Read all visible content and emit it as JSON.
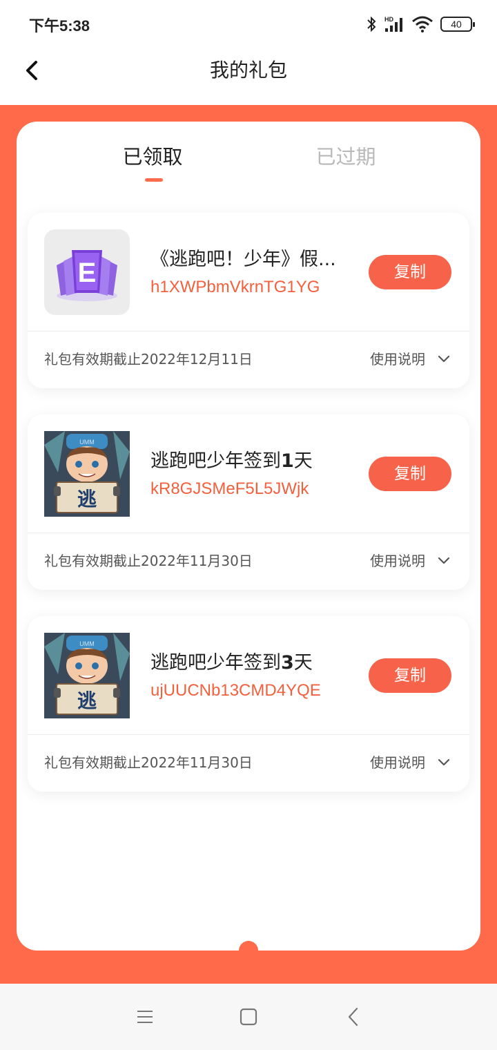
{
  "status_bar": {
    "time": "下午5:38",
    "icons": [
      "bluetooth-icon",
      "signal-icon",
      "wifi-icon"
    ],
    "hd_label": "HD",
    "battery": "40"
  },
  "header": {
    "title": "我的礼包",
    "back_icon": "chevron-left-icon"
  },
  "tabs": [
    {
      "label": "已领取",
      "active": true
    },
    {
      "label": "已过期",
      "active": false
    }
  ],
  "colors": {
    "accent": "#ff6b4a",
    "code_text": "#f2603e",
    "inactive_tab": "#b8b8b8"
  },
  "gifts": [
    {
      "name": "《逃跑吧！少年》假...",
      "code": "h1XWPbmVkrnTG1YG",
      "copy_label": "复制",
      "expiry": "礼包有效期截止2022年12月11日",
      "usage_label": "使用说明",
      "icon": "card-e-icon"
    },
    {
      "name_prefix": "逃跑吧少年签到",
      "name_number": "1",
      "name_suffix": "天",
      "code": "kR8GJSMeF5L5JWjk",
      "copy_label": "复制",
      "expiry": "礼包有效期截止2022年11月30日",
      "usage_label": "使用说明",
      "icon": "game-character-icon",
      "icon_text": "逃"
    },
    {
      "name_prefix": "逃跑吧少年签到",
      "name_number": "3",
      "name_suffix": "天",
      "code": "ujUUCNb13CMD4YQE",
      "copy_label": "复制",
      "expiry": "礼包有效期截止2022年11月30日",
      "usage_label": "使用说明",
      "icon": "game-character-icon",
      "icon_text": "逃"
    }
  ],
  "nav_bar": {
    "buttons": [
      "menu-icon",
      "home-icon",
      "back-icon"
    ]
  }
}
